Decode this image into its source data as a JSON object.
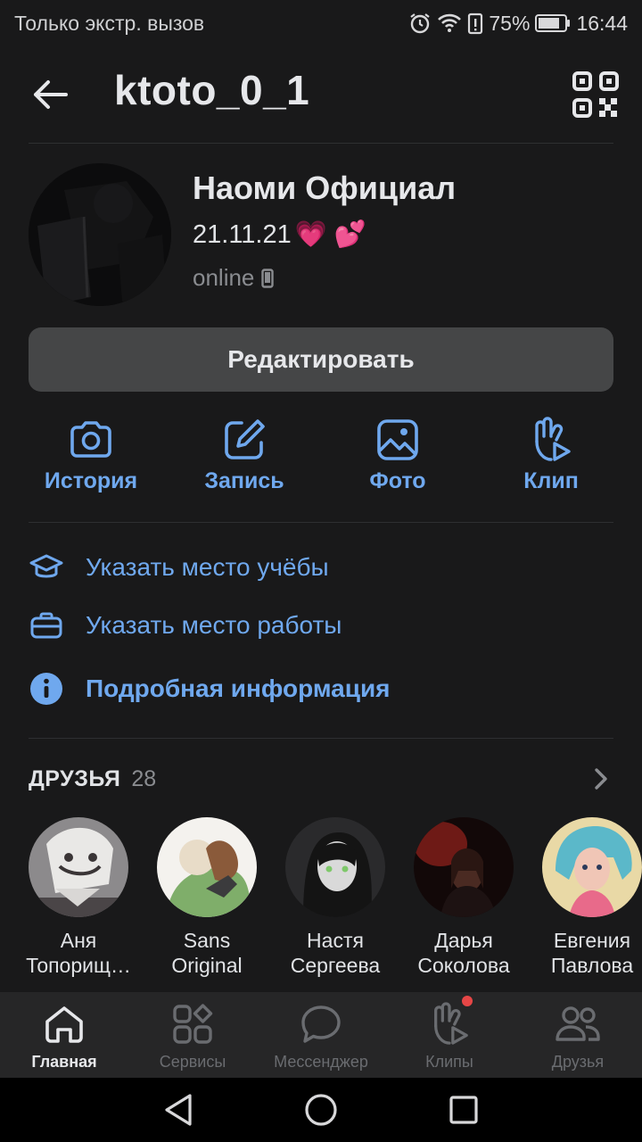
{
  "statusbar": {
    "carrier": "Только экстр. вызов",
    "battery": "75%",
    "time": "16:44"
  },
  "header": {
    "title": "ktoto_0_1"
  },
  "profile": {
    "name": "Наоми Официал",
    "status_text": "21.11.21",
    "status_emoji": "💗 💕",
    "online": "online"
  },
  "edit_button": "Редактировать",
  "actions": [
    {
      "label": "История",
      "icon": "camera-icon"
    },
    {
      "label": "Запись",
      "icon": "edit-icon"
    },
    {
      "label": "Фото",
      "icon": "image-icon"
    },
    {
      "label": "Клип",
      "icon": "clip-icon"
    }
  ],
  "info": {
    "study": "Указать место учёбы",
    "work": "Указать место работы",
    "details": "Подробная информация"
  },
  "friends": {
    "title": "ДРУЗЬЯ",
    "count": "28",
    "items": [
      {
        "line1": "Аня",
        "line2": "Топорищ…"
      },
      {
        "line1": "Sans",
        "line2": "Original"
      },
      {
        "line1": "Настя",
        "line2": "Сергеева"
      },
      {
        "line1": "Дарья",
        "line2": "Соколова"
      },
      {
        "line1": "Евгения",
        "line2": "Павлова"
      }
    ]
  },
  "tabbar": [
    {
      "label": "Главная",
      "icon": "home-icon",
      "active": true
    },
    {
      "label": "Сервисы",
      "icon": "services-icon"
    },
    {
      "label": "Мессенджер",
      "icon": "messenger-icon"
    },
    {
      "label": "Клипы",
      "icon": "clips-icon",
      "badge": true
    },
    {
      "label": "Друзья",
      "icon": "friends-icon"
    }
  ],
  "colors": {
    "accent": "#6fa8ee",
    "background": "#19191a",
    "badge": "#e64646"
  }
}
